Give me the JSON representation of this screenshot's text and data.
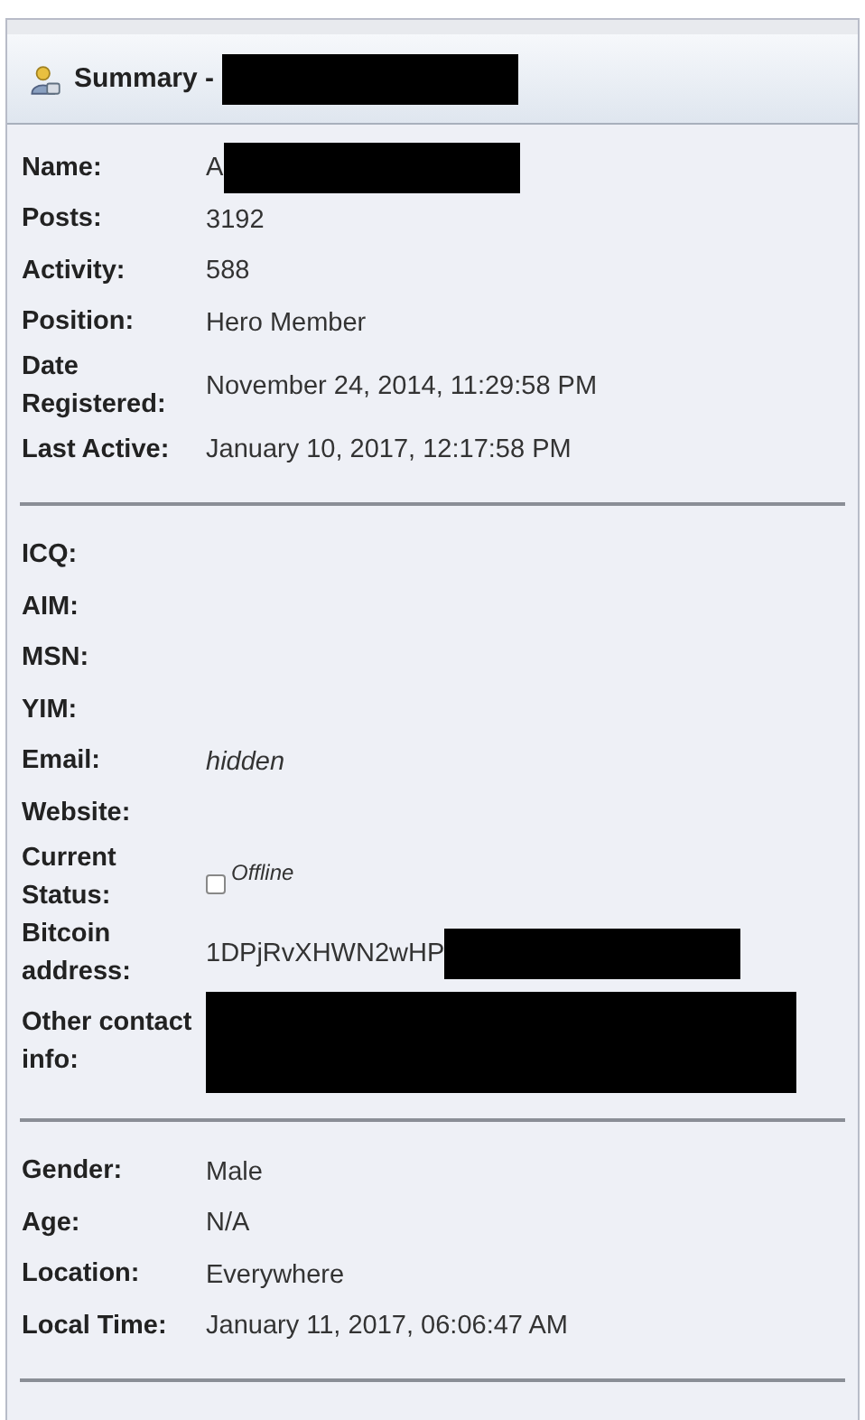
{
  "header": {
    "title": "Summary -",
    "redacted": true
  },
  "sections": [
    {
      "rows": [
        {
          "kind": "text",
          "label": "Name:",
          "value": "A",
          "redacted": true
        },
        {
          "kind": "text",
          "label": "Posts:",
          "value": "3192"
        },
        {
          "kind": "text",
          "label": "Activity:",
          "value": "588"
        },
        {
          "kind": "text",
          "label": "Position:",
          "value": "Hero Member"
        },
        {
          "kind": "text",
          "label": "Date Registered:",
          "value": "November 24, 2014, 11:29:58 PM"
        },
        {
          "kind": "text",
          "label": "Last Active:",
          "value": "January 10, 2017, 12:17:58 PM"
        }
      ]
    },
    {
      "rows": [
        {
          "kind": "text",
          "label": "ICQ:"
        },
        {
          "kind": "text",
          "label": "AIM:"
        },
        {
          "kind": "text",
          "label": "MSN:"
        },
        {
          "kind": "text",
          "label": "YIM:"
        },
        {
          "kind": "text",
          "label": "Email:",
          "value": "hidden",
          "italic": true
        },
        {
          "kind": "text",
          "label": "Website:"
        },
        {
          "kind": "status",
          "label": "Current Status:",
          "value": "Offline",
          "online": false
        },
        {
          "kind": "text",
          "label": "Bitcoin address:",
          "value": "1DPjRvXHWN2wHP",
          "redacted": true
        },
        {
          "kind": "redacted",
          "label": "Other contact info:"
        }
      ]
    },
    {
      "rows": [
        {
          "kind": "text",
          "label": "Gender:",
          "value": "Male"
        },
        {
          "kind": "text",
          "label": "Age:",
          "value": "N/A"
        },
        {
          "kind": "text",
          "label": "Location:",
          "value": "Everywhere"
        },
        {
          "kind": "text",
          "label": "Local Time:",
          "value": "January 11, 2017, 06:06:47 AM"
        }
      ]
    }
  ]
}
